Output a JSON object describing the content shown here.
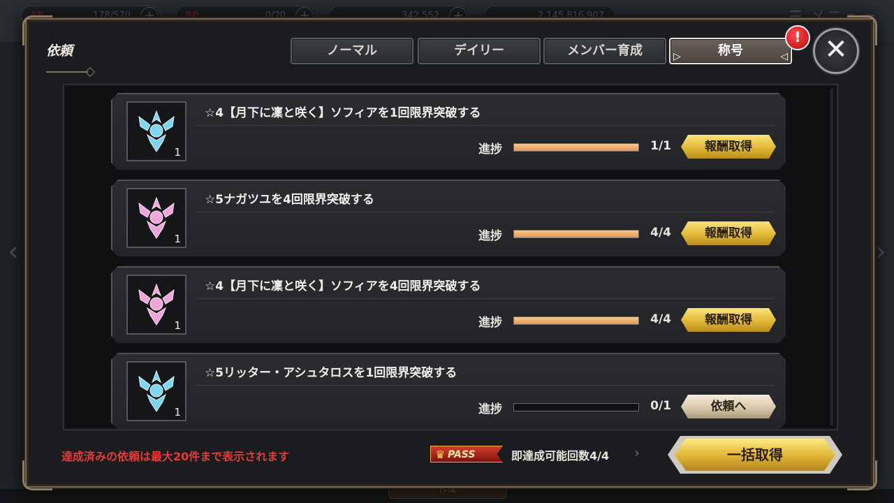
{
  "background": {
    "hud_values": [
      "178/570",
      "0/20",
      "342,552",
      "2,145,816,907"
    ],
    "hud_labels": [
      "AP",
      "BP"
    ],
    "menu_label": "メニュー",
    "bottom_plate": "作成"
  },
  "dialog": {
    "title": "依頼",
    "tabs": [
      {
        "label": "ノーマル",
        "active": false
      },
      {
        "label": "デイリー",
        "active": false
      },
      {
        "label": "メンバー育成",
        "active": false
      },
      {
        "label": "称号",
        "active": true
      }
    ],
    "alert_badge": "!",
    "close_icon": "close-icon"
  },
  "quests": [
    {
      "title": "☆4【月下に凜と咲く】ソフィアを1回限界突破する",
      "icon_color": "#7fd4ee",
      "count": "1",
      "progress_label": "進捗",
      "progress": "1/1",
      "progress_fraction": 1.0,
      "button": "報酬取得",
      "button_type": "reward"
    },
    {
      "title": "☆5ナガツユを4回限界突破する",
      "icon_color": "#f0a6da",
      "count": "1",
      "progress_label": "進捗",
      "progress": "4/4",
      "progress_fraction": 1.0,
      "button": "報酬取得",
      "button_type": "reward"
    },
    {
      "title": "☆4【月下に凜と咲く】ソフィアを4回限界突破する",
      "icon_color": "#f0a6da",
      "count": "1",
      "progress_label": "進捗",
      "progress": "4/4",
      "progress_fraction": 1.0,
      "button": "報酬取得",
      "button_type": "reward"
    },
    {
      "title": "☆5リッター・アシュタロスを1回限界突破する",
      "icon_color": "#7fd4ee",
      "count": "1",
      "progress_label": "進捗",
      "progress": "0/1",
      "progress_fraction": 0.0,
      "button": "依頼へ",
      "button_type": "goto"
    }
  ],
  "footer": {
    "note": "達成済みの依頼は最大20件まで表示されます",
    "pass_tag": "PASS",
    "pass_text": "即達成可能回数4/4",
    "bulk_button": "一括取得"
  }
}
